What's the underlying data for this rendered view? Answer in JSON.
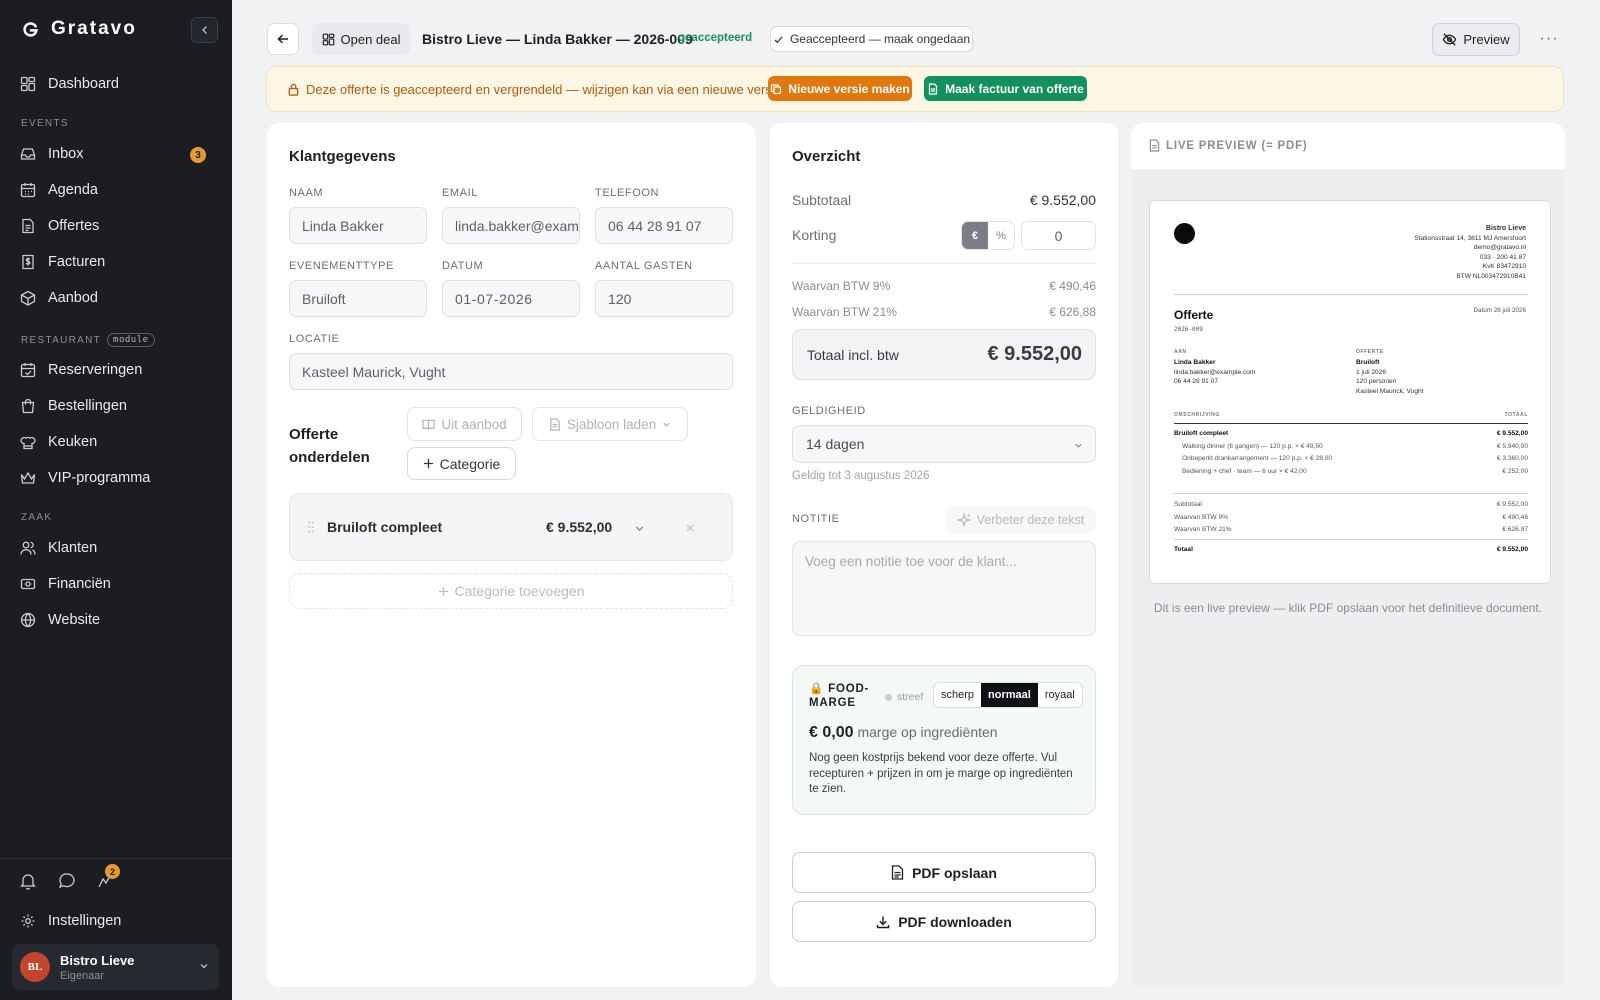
{
  "app": {
    "name": "Gratavo"
  },
  "sidebar": {
    "top_items": [
      {
        "label": "Dashboard"
      }
    ],
    "sections": [
      {
        "title": "EVENTS",
        "items": [
          {
            "label": "Inbox",
            "badge": "3"
          },
          {
            "label": "Agenda"
          },
          {
            "label": "Offertes"
          },
          {
            "label": "Facturen"
          },
          {
            "label": "Aanbod"
          }
        ]
      },
      {
        "title": "RESTAURANT",
        "pill": "module",
        "items": [
          {
            "label": "Reserveringen"
          },
          {
            "label": "Bestellingen"
          },
          {
            "label": "Keuken"
          },
          {
            "label": "VIP-programma"
          }
        ]
      },
      {
        "title": "ZAAK",
        "items": [
          {
            "label": "Klanten"
          },
          {
            "label": "Financiën"
          },
          {
            "label": "Website"
          }
        ]
      }
    ],
    "bottom": {
      "settings_label": "Instellingen",
      "activity_badge": "2"
    },
    "user": {
      "initials": "BL",
      "name": "Bistro Lieve",
      "role": "Eigenaar"
    }
  },
  "topbar": {
    "open_deal_label": "Open deal",
    "title": "Bistro Lieve — Linda Bakker — 2026-009",
    "status": "geaccepteerd",
    "undo_label": "Geaccepteerd — maak ongedaan",
    "preview_label": "Preview",
    "more_label": "···"
  },
  "banner": {
    "text": "Deze offerte is geaccepteerd en vergrendeld — wijzigen kan via een nieuwe versie.",
    "new_version_label": "Nieuwe versie maken",
    "invoice_label": "Maak factuur van offerte"
  },
  "customer": {
    "title": "Klantgegevens",
    "name_label": "NAAM",
    "name": "Linda Bakker",
    "email_label": "EMAIL",
    "email": "linda.bakker@example.com",
    "phone_label": "TELEFOON",
    "phone": "06 44 28 91 07",
    "event_type_label": "EVENEMENTTYPE",
    "event_type": "Bruiloft",
    "date_label": "DATUM",
    "date": "01-07-2026",
    "guests_label": "AANTAL GASTEN",
    "guests": "120",
    "location_label": "LOCATIE",
    "location": "Kasteel Maurick, Vught"
  },
  "parts": {
    "title_line1": "Offerte",
    "title_line2": "onderdelen",
    "from_catalog_label": "Uit aanbod",
    "load_template_label": "Sjabloon laden",
    "category_label": "Categorie",
    "categories": [
      {
        "name": "Bruiloft compleet",
        "amount": "€ 9.552,00"
      }
    ],
    "add_category_label": "Categorie toevoegen"
  },
  "overview": {
    "title": "Overzicht",
    "subtotal_label": "Subtotaal",
    "subtotal": "€ 9.552,00",
    "discount_label": "Korting",
    "discount_mode_eur": "€",
    "discount_mode_pct": "%",
    "discount_value": "0",
    "vat9_label": "Waarvan BTW 9%",
    "vat9": "€ 490,46",
    "vat21_label": "Waarvan BTW 21%",
    "vat21": "€ 626,88",
    "total_label": "Totaal incl. btw",
    "total": "€ 9.552,00",
    "validity_label": "GELDIGHEID",
    "validity": "14 dagen",
    "valid_until": "Geldig tot 3 augustus 2026",
    "note_label": "NOTITIE",
    "improve_label": "Verbeter deze tekst",
    "note_placeholder": "Voeg een notitie toe voor de klant...",
    "food": {
      "icon": "🔒",
      "title_line1": "FOOD-",
      "title_line2": "MARGE",
      "strive_label": "streef",
      "options": [
        "scherp",
        "normaal",
        "royaal"
      ],
      "selected": "normaal",
      "amount": "€ 0,00",
      "amount_suffix": "marge op ingrediënten",
      "note": "Nog geen kostprijs bekend voor deze offerte. Vul recepturen + prijzen in om je marge op ingrediënten te zien."
    },
    "pdf_save_label": "PDF opslaan",
    "pdf_download_label": "PDF downloaden"
  },
  "live_preview": {
    "title": "LIVE PREVIEW (= PDF)",
    "caption": "Dit is een live preview — klik PDF opslaan voor het definitieve document.",
    "doc": {
      "company": "Bistro Lieve",
      "company_lines": [
        "Stationsstraat 14, 3811 MJ Amersfoort",
        "demo@gratavo.nl",
        "033 · 200 41 87",
        "KvK 83472910",
        "BTW NL003472910B41"
      ],
      "heading": "Offerte",
      "number": "2026-009",
      "date": "Datum 28 juli 2026",
      "to_label": "AAN",
      "to_lines": [
        "Linda Bakker",
        "linda.bakker@example.com",
        "06 44 28 91 07"
      ],
      "quote_label": "OFFERTE",
      "quote_lines": [
        "Bruiloft",
        "1 juli 2026",
        "120 personen",
        "Kasteel Maurick, Vught"
      ],
      "col_desc": "OMSCHRIJVING",
      "col_total": "TOTAAL",
      "group": {
        "name": "Bruiloft compleet",
        "amount": "€ 9.552,00"
      },
      "lines": [
        {
          "desc": "Walking dinner (6 gangen) — 120 p.p. × € 49,50",
          "amount": "€ 5.940,00"
        },
        {
          "desc": "Onbeperkt drankarrangement — 120 p.p. × € 28,00",
          "amount": "€ 3.360,00"
        },
        {
          "desc": "Bediening + chef · team — 6 uur × € 42,00",
          "amount": "€ 252,00"
        }
      ],
      "subtotal_label": "Subtotaal",
      "subtotal": "€ 9.552,00",
      "vat9_label": "Waarvan BTW 9%",
      "vat9": "€ 490,46",
      "vat21_label": "Waarvan BTW 21%",
      "vat21": "€ 626,87",
      "total_label": "Totaal",
      "total": "€ 9.552,00"
    }
  },
  "colors": {
    "sidebar_bg": "#1b1d23",
    "accent_orange": "#e0780e",
    "accent_green": "#13915d",
    "badge": "#e69a2e",
    "banner_bg": "#fcf6e4"
  }
}
